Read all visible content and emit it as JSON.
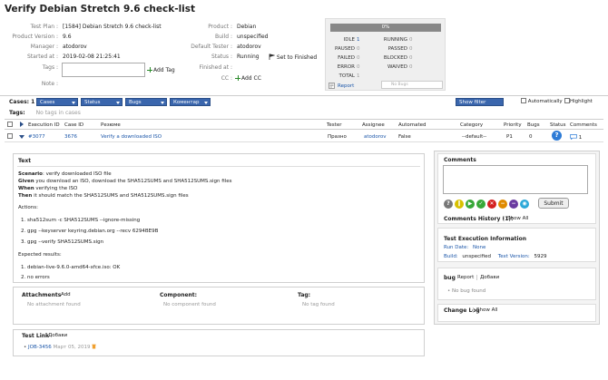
{
  "page_title": "Verify Debian Stretch 9.6 check-list",
  "fields": {
    "test_plan_label": "Test Plan :",
    "test_plan": "[1584] Debian Stretch 9.6 check-list",
    "product_version_label": "Product Version :",
    "product_version": "9.6",
    "manager_label": "Manager :",
    "manager": "atodorov",
    "started_at_label": "Started at :",
    "started_at": "2019-02-08 21:25:41",
    "tags_label": "Tags :",
    "add_tag": "Add Tag",
    "note_label": "Note :",
    "product_label": "Product :",
    "product": "Debian",
    "build_label": "Build :",
    "build": "unspecified",
    "default_tester_label": "Default Tester :",
    "default_tester": "atodorov",
    "status_label": "Status :",
    "status": "Running",
    "set_finished": "Set to Finished",
    "finished_at_label": "Finished at :",
    "cc_label": "CC :",
    "add_cc": "Add CC"
  },
  "stats": {
    "progress": "0%",
    "idle_label": "IDLE",
    "idle": "1",
    "running_label": "RUNNING",
    "running": "0",
    "paused_label": "PAUSED",
    "paused": "0",
    "passed_label": "PASSED",
    "passed": "0",
    "failed_label": "FAILED",
    "failed": "0",
    "blocked_label": "BLOCKED",
    "blocked": "0",
    "error_label": "ERROR",
    "error": "0",
    "waived_label": "WAIVED",
    "waived": "0",
    "total_label": "TOTAL",
    "total": "1",
    "report": "Report",
    "no_bugs": "No Bugs"
  },
  "toolbar": {
    "cases_label": "Cases: 1",
    "cases_btn": "Cases",
    "status_btn": "Status",
    "bugs_btn": "Bugs",
    "comment_btn": "Коментар",
    "show_filter": "Show filter options",
    "automatically": "Automatically",
    "highlight": "Highlight"
  },
  "tags_bar": {
    "label": "Tags:",
    "none": "No tags in cases"
  },
  "table": {
    "headers": {
      "execution_id": "Execution ID",
      "case_id": "Case ID",
      "summary": "Резюме",
      "tester": "Tester",
      "assignee": "Assignee",
      "automated": "Automated",
      "category": "Category",
      "priority": "Priority",
      "bugs": "Bugs",
      "status": "Status",
      "comments": "Comments"
    },
    "row": {
      "execution_id": "#3077",
      "case_id": "3676",
      "summary": "Verify a downloaded ISO",
      "tester": "Празно",
      "assignee": "atodorov",
      "automated": "False",
      "category": "--default--",
      "priority": "P1",
      "bugs": "0",
      "status_icon": "question-icon",
      "comments": "1"
    }
  },
  "text_section": {
    "title": "Text",
    "scenario_label": "Scenario",
    "scenario": ": verify downloaded ISO file",
    "given_label": "Given",
    "given": " you download an ISO, download the SHA512SUMS and SHA512SUMS.sign files",
    "when_label": "When",
    "when": " verifying the ISO",
    "then_label": "Then",
    "then": " it should match the SHA512SUMS and SHA512SUMS.sign files",
    "actions_label": "Actions:",
    "actions": [
      "1. sha512sum -c SHA512SUMS --ignore-missing",
      "2. gpg --keyserver keyring.debian.org --recv 6294BE9B",
      "3. gpg --verify SHA512SUMS.sign"
    ],
    "expected_label": "Expected results:",
    "expected": [
      "1. debian-live-9.6.0-amd64-xfce.iso: OK",
      "2. no errors"
    ]
  },
  "attachments": {
    "title": "Attachments",
    "add": "Add",
    "none": "No attachment found"
  },
  "component": {
    "title": "Component:",
    "none": "No component found"
  },
  "tag": {
    "title": "Tag:",
    "none": "No tag found"
  },
  "test_link": {
    "title": "Test Link",
    "add": "Добави",
    "item": "JOB-3456",
    "date": "Март 05, 2019"
  },
  "right": {
    "comments_title": "Comments",
    "submit": "Submit",
    "comments_history": "Comments History (1):",
    "show_all": "Show All",
    "exec_info_title": "Test Execution Information",
    "run_date_label": "Run Date:",
    "run_date": "None",
    "build_label": "Build:",
    "build": "unspecified",
    "text_version_label": "Text Version:",
    "text_version": "5929",
    "bug_title": "bug",
    "bug_report": "Report",
    "bug_add": "Добави",
    "no_bug": "No bug found",
    "changelog_title": "Change Log",
    "changelog_show_all": "Show All"
  },
  "colors": {
    "accent": "#3a66ad",
    "link": "#1a55a8",
    "status_blue": "#2d7bd6"
  }
}
